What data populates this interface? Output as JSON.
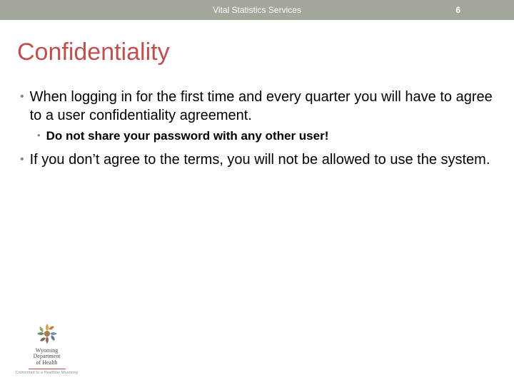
{
  "header": {
    "title": "Vital Statistics Services",
    "page_number": "6"
  },
  "slide": {
    "title": "Confidentiality"
  },
  "bullets": {
    "b1_text": "When logging in for the first time and every quarter you will have to agree to a user confidentiality agreement.",
    "b1_sub_text": "Do not share your password with any other user!",
    "b2_text": "If you don’t agree to the terms, you will not be allowed to use the system."
  },
  "logo": {
    "line1": "Wyoming",
    "line2": "Department",
    "line3": "of Health",
    "tagline": "Committed to a Healthier Wyoming"
  },
  "bullet_char": "•"
}
